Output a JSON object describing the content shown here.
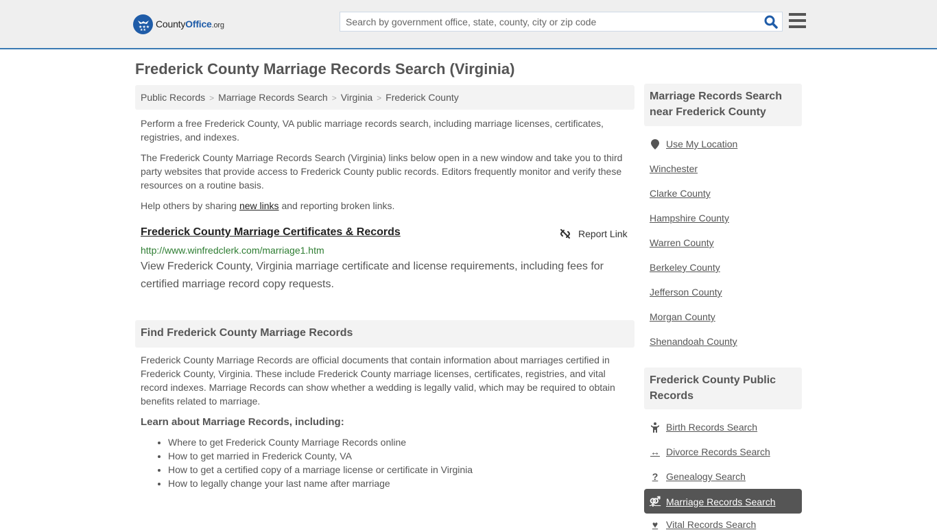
{
  "header": {
    "logo": {
      "prefix": "County",
      "brand": "Office",
      "tld": ".org"
    },
    "search": {
      "placeholder": "Search by government office, state, county, city or zip code",
      "value": ""
    },
    "icons": {
      "search": "search-icon",
      "menu": "hamburger-menu-icon"
    },
    "accent_color": "#3a7ab3"
  },
  "page_title": "Frederick County Marriage Records Search (Virginia)",
  "breadcrumb": [
    "Public Records",
    "Marriage Records Search",
    "Virginia",
    "Frederick County"
  ],
  "intro": {
    "p1": "Perform a free Frederick County, VA public marriage records search, including marriage licenses, certificates, registries, and indexes.",
    "p2": "The Frederick County Marriage Records Search (Virginia) links below open in a new window and take you to third party websites that provide access to Frederick County public records. Editors frequently monitor and verify these resources on a routine basis.",
    "p3_before": "Help others by sharing ",
    "p3_link": "new links",
    "p3_after": " and reporting broken links."
  },
  "result": {
    "title": "Frederick County Marriage Certificates & Records",
    "url": "http://www.winfredclerk.com/marriage1.htm",
    "description": "View Frederick County, Virginia marriage certificate and license requirements, including fees for certified marriage record copy requests.",
    "report_label": "Report Link"
  },
  "find_section": {
    "heading": "Find Frederick County Marriage Records",
    "body": "Frederick County Marriage Records are official documents that contain information about marriages certified in Frederick County, Virginia. These include Frederick County marriage licenses, certificates, registries, and vital record indexes. Marriage Records can show whether a wedding is legally valid, which may be required to obtain benefits related to marriage.",
    "learn_heading": "Learn about Marriage Records, including:",
    "learn_items": [
      "Where to get Frederick County Marriage Records online",
      "How to get married in Frederick County, VA",
      "How to get a certified copy of a marriage license or certificate in Virginia",
      "How to legally change your last name after marriage"
    ]
  },
  "sidebar": {
    "nearby_heading": "Marriage Records Search near Frederick County",
    "use_location": "Use My Location",
    "nearby": [
      "Winchester",
      "Clarke County",
      "Hampshire County",
      "Warren County",
      "Berkeley County",
      "Jefferson County",
      "Morgan County",
      "Shenandoah County"
    ],
    "public_heading": "Frederick County Public Records",
    "public_links": [
      {
        "label": "Birth Records Search",
        "icon": "child-icon"
      },
      {
        "label": "Divorce Records Search",
        "icon": "arrows-horizontal-icon"
      },
      {
        "label": "Genealogy Search",
        "icon": "question-icon"
      },
      {
        "label": "Marriage Records Search",
        "icon": "venus-mars-icon",
        "active": true
      },
      {
        "label": "Vital Records Search",
        "icon": "heartbeat-icon"
      }
    ]
  }
}
